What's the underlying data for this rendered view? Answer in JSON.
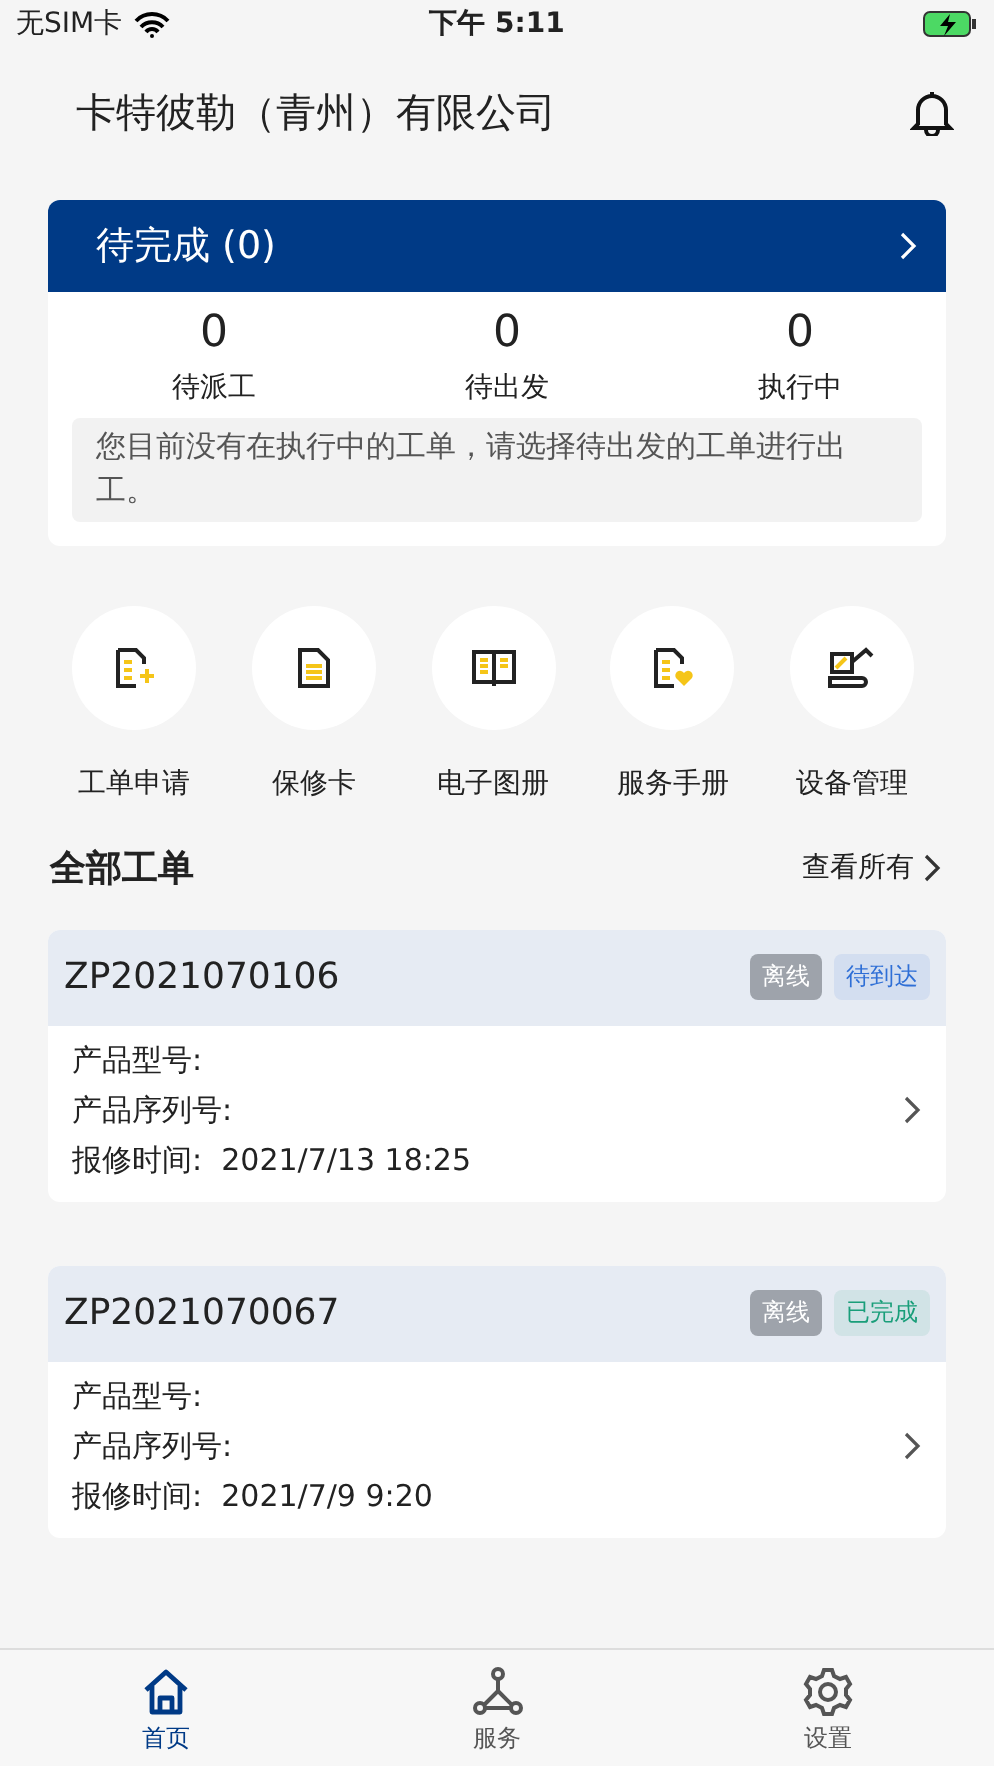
{
  "status_bar": {
    "carrier": "无SIM卡",
    "time": "下午 5:11"
  },
  "header": {
    "title": "卡特彼勒（青州）有限公司"
  },
  "pending": {
    "title": "待完成 (0)",
    "stats": [
      {
        "value": "0",
        "label": "待派工"
      },
      {
        "value": "0",
        "label": "待出发"
      },
      {
        "value": "0",
        "label": "执行中"
      }
    ],
    "notice": "您目前没有在执行中的工单，请选择待出发的工单进行出工。"
  },
  "shortcuts": [
    {
      "kind": "doc-add",
      "label": "工单申请"
    },
    {
      "kind": "doc",
      "label": "保修卡"
    },
    {
      "kind": "book",
      "label": "电子图册"
    },
    {
      "kind": "doc-heart",
      "label": "服务手册"
    },
    {
      "kind": "excavator",
      "label": "设备管理"
    }
  ],
  "orders_section": {
    "title": "全部工单",
    "link": "查看所有"
  },
  "orders": [
    {
      "number": "ZP2021070106",
      "offline_tag": "离线",
      "status": "待到达",
      "color": "#2f6fd6",
      "fields": [
        {
          "label": "产品型号:"
        },
        {
          "label": "产品序列号:"
        },
        {
          "label": "报修时间:",
          "value": "2021/7/13 18:25"
        }
      ]
    },
    {
      "number": "ZP2021070067",
      "offline_tag": "离线",
      "status": "已完成",
      "color": "#1a9e7a",
      "fields": [
        {
          "label": "产品型号:"
        },
        {
          "label": "产品序列号:"
        },
        {
          "label": "报修时间:",
          "value": "2021/7/9 9:20"
        }
      ]
    }
  ],
  "tab_bar": [
    {
      "kind": "home",
      "label": "首页",
      "selected": true
    },
    {
      "kind": "service",
      "label": "服务",
      "selected": false
    },
    {
      "kind": "settings",
      "label": "设置",
      "selected": false
    }
  ]
}
